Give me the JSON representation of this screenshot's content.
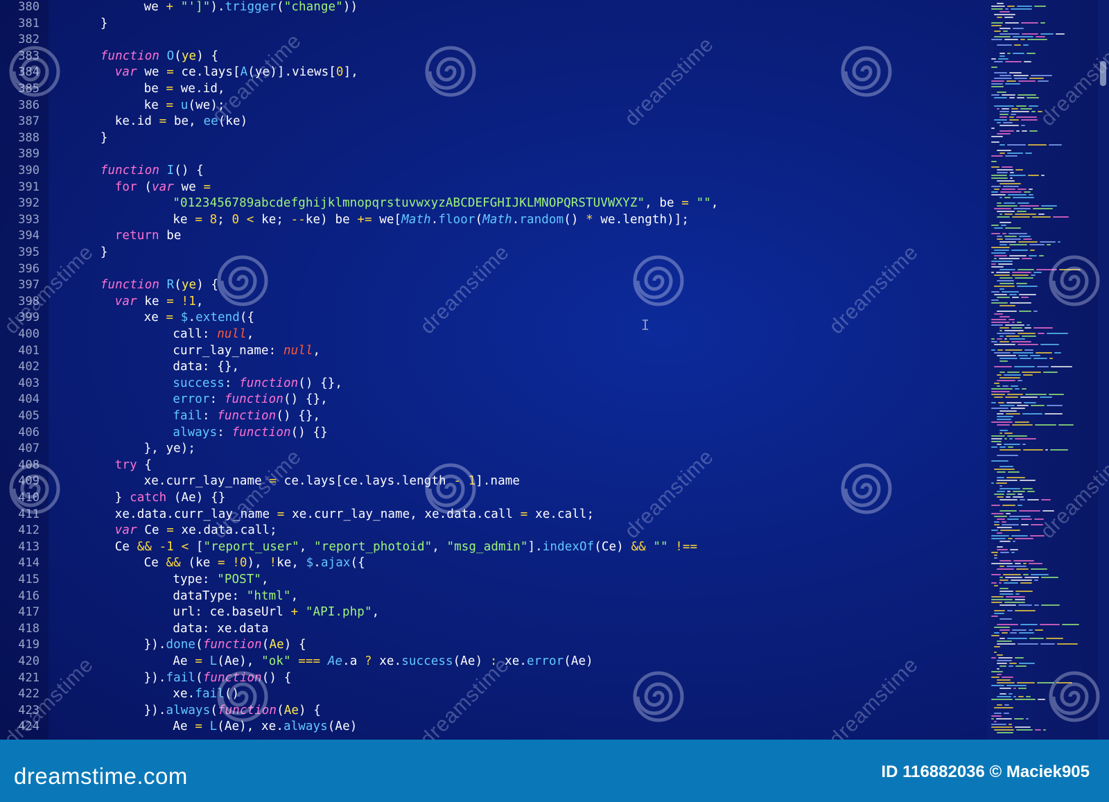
{
  "editor": {
    "lines": [
      {
        "n": "380",
        "indent": 8,
        "tokens": [
          [
            "plain",
            "we "
          ],
          [
            "op",
            "+"
          ],
          [
            "plain",
            " "
          ],
          [
            "str",
            "\"']\""
          ],
          [
            "plain",
            ")."
          ],
          [
            "fn",
            "trigger"
          ],
          [
            "plain",
            "("
          ],
          [
            "str",
            "\"change\""
          ],
          [
            "plain",
            "))"
          ]
        ]
      },
      {
        "n": "381",
        "indent": 2,
        "tokens": [
          [
            "plain",
            "}"
          ]
        ]
      },
      {
        "n": "382",
        "indent": 0,
        "tokens": []
      },
      {
        "n": "383",
        "indent": 2,
        "tokens": [
          [
            "kw",
            "function"
          ],
          [
            "plain",
            " "
          ],
          [
            "fn",
            "O"
          ],
          [
            "plain",
            "("
          ],
          [
            "prm",
            "ye"
          ],
          [
            "plain",
            ") {"
          ]
        ]
      },
      {
        "n": "384",
        "indent": 4,
        "tokens": [
          [
            "kw",
            "var"
          ],
          [
            "plain",
            " we "
          ],
          [
            "op",
            "="
          ],
          [
            "plain",
            " ce.lays["
          ],
          [
            "fn",
            "A"
          ],
          [
            "plain",
            "(ye)].views["
          ],
          [
            "num",
            "0"
          ],
          [
            "plain",
            "],"
          ]
        ]
      },
      {
        "n": "385",
        "indent": 8,
        "tokens": [
          [
            "plain",
            "be "
          ],
          [
            "op",
            "="
          ],
          [
            "plain",
            " we.id,"
          ]
        ]
      },
      {
        "n": "386",
        "indent": 8,
        "tokens": [
          [
            "plain",
            "ke "
          ],
          [
            "op",
            "="
          ],
          [
            "plain",
            " "
          ],
          [
            "fn",
            "u"
          ],
          [
            "plain",
            "(we);"
          ]
        ]
      },
      {
        "n": "387",
        "indent": 4,
        "tokens": [
          [
            "plain",
            "ke.id "
          ],
          [
            "op",
            "="
          ],
          [
            "plain",
            " be, "
          ],
          [
            "fn",
            "ee"
          ],
          [
            "plain",
            "(ke)"
          ]
        ]
      },
      {
        "n": "388",
        "indent": 2,
        "tokens": [
          [
            "plain",
            "}"
          ]
        ]
      },
      {
        "n": "389",
        "indent": 0,
        "tokens": []
      },
      {
        "n": "390",
        "indent": 2,
        "tokens": [
          [
            "kw",
            "function"
          ],
          [
            "plain",
            " "
          ],
          [
            "fn",
            "I"
          ],
          [
            "plain",
            "() {"
          ]
        ]
      },
      {
        "n": "391",
        "indent": 4,
        "tokens": [
          [
            "ctl",
            "for"
          ],
          [
            "plain",
            " ("
          ],
          [
            "kw",
            "var"
          ],
          [
            "plain",
            " we "
          ],
          [
            "op",
            "="
          ]
        ]
      },
      {
        "n": "392",
        "indent": 12,
        "tokens": [
          [
            "str",
            "\"0123456789abcdefghijklmnopqrstuvwxyzABCDEFGHIJKLMNOPQRSTUVWXYZ\""
          ],
          [
            "plain",
            ", be "
          ],
          [
            "op",
            "="
          ],
          [
            "plain",
            " "
          ],
          [
            "str",
            "\"\""
          ],
          [
            "plain",
            ","
          ]
        ]
      },
      {
        "n": "393",
        "indent": 12,
        "tokens": [
          [
            "plain",
            "ke "
          ],
          [
            "op",
            "="
          ],
          [
            "plain",
            " "
          ],
          [
            "num",
            "8"
          ],
          [
            "plain",
            "; "
          ],
          [
            "num",
            "0"
          ],
          [
            "plain",
            " "
          ],
          [
            "op",
            "<"
          ],
          [
            "plain",
            " ke; "
          ],
          [
            "op",
            "--"
          ],
          [
            "plain",
            "ke) be "
          ],
          [
            "op",
            "+="
          ],
          [
            "plain",
            " we["
          ],
          [
            "cls",
            "Math"
          ],
          [
            "plain",
            "."
          ],
          [
            "fn",
            "floor"
          ],
          [
            "plain",
            "("
          ],
          [
            "cls",
            "Math"
          ],
          [
            "plain",
            "."
          ],
          [
            "fn",
            "random"
          ],
          [
            "plain",
            "() "
          ],
          [
            "op",
            "*"
          ],
          [
            "plain",
            " we.length)];"
          ]
        ]
      },
      {
        "n": "394",
        "indent": 4,
        "tokens": [
          [
            "ctl",
            "return"
          ],
          [
            "plain",
            " be"
          ]
        ]
      },
      {
        "n": "395",
        "indent": 2,
        "tokens": [
          [
            "plain",
            "}"
          ]
        ]
      },
      {
        "n": "396",
        "indent": 0,
        "tokens": []
      },
      {
        "n": "397",
        "indent": 2,
        "tokens": [
          [
            "kw",
            "function"
          ],
          [
            "plain",
            " "
          ],
          [
            "fn",
            "R"
          ],
          [
            "plain",
            "("
          ],
          [
            "prm",
            "ye"
          ],
          [
            "plain",
            ") {"
          ]
        ]
      },
      {
        "n": "398",
        "indent": 4,
        "tokens": [
          [
            "kw",
            "var"
          ],
          [
            "plain",
            " ke "
          ],
          [
            "op",
            "="
          ],
          [
            "plain",
            " "
          ],
          [
            "op",
            "!"
          ],
          [
            "num",
            "1"
          ],
          [
            "plain",
            ","
          ]
        ]
      },
      {
        "n": "399",
        "indent": 8,
        "tokens": [
          [
            "plain",
            "xe "
          ],
          [
            "op",
            "="
          ],
          [
            "plain",
            " "
          ],
          [
            "fn",
            "$"
          ],
          [
            "plain",
            "."
          ],
          [
            "fn",
            "extend"
          ],
          [
            "plain",
            "({"
          ]
        ]
      },
      {
        "n": "400",
        "indent": 12,
        "tokens": [
          [
            "plain",
            "call: "
          ],
          [
            "nul",
            "null"
          ],
          [
            "plain",
            ","
          ]
        ]
      },
      {
        "n": "401",
        "indent": 12,
        "tokens": [
          [
            "plain",
            "curr_lay_name: "
          ],
          [
            "nul",
            "null"
          ],
          [
            "plain",
            ","
          ]
        ]
      },
      {
        "n": "402",
        "indent": 12,
        "tokens": [
          [
            "plain",
            "data: {},"
          ]
        ]
      },
      {
        "n": "403",
        "indent": 12,
        "tokens": [
          [
            "key",
            "success"
          ],
          [
            "plain",
            ": "
          ],
          [
            "kw",
            "function"
          ],
          [
            "plain",
            "() {},"
          ]
        ]
      },
      {
        "n": "404",
        "indent": 12,
        "tokens": [
          [
            "key",
            "error"
          ],
          [
            "plain",
            ": "
          ],
          [
            "kw",
            "function"
          ],
          [
            "plain",
            "() {},"
          ]
        ]
      },
      {
        "n": "405",
        "indent": 12,
        "tokens": [
          [
            "key",
            "fail"
          ],
          [
            "plain",
            ": "
          ],
          [
            "kw",
            "function"
          ],
          [
            "plain",
            "() {},"
          ]
        ]
      },
      {
        "n": "406",
        "indent": 12,
        "tokens": [
          [
            "key",
            "always"
          ],
          [
            "plain",
            ": "
          ],
          [
            "kw",
            "function"
          ],
          [
            "plain",
            "() {}"
          ]
        ]
      },
      {
        "n": "407",
        "indent": 8,
        "tokens": [
          [
            "plain",
            "}, ye);"
          ]
        ]
      },
      {
        "n": "408",
        "indent": 4,
        "tokens": [
          [
            "ctl",
            "try"
          ],
          [
            "plain",
            " {"
          ]
        ]
      },
      {
        "n": "409",
        "indent": 8,
        "tokens": [
          [
            "plain",
            "xe.curr_lay_name "
          ],
          [
            "op",
            "="
          ],
          [
            "plain",
            " ce.lays[ce.lays.length "
          ],
          [
            "op",
            "-"
          ],
          [
            "plain",
            " "
          ],
          [
            "num",
            "1"
          ],
          [
            "plain",
            "].name"
          ]
        ]
      },
      {
        "n": "410",
        "indent": 4,
        "tokens": [
          [
            "plain",
            "} "
          ],
          [
            "ctl",
            "catch"
          ],
          [
            "plain",
            " (Ae) {}"
          ]
        ]
      },
      {
        "n": "411",
        "indent": 4,
        "tokens": [
          [
            "plain",
            "xe.data.curr_lay_name "
          ],
          [
            "op",
            "="
          ],
          [
            "plain",
            " xe.curr_lay_name, xe.data.call "
          ],
          [
            "op",
            "="
          ],
          [
            "plain",
            " xe.call;"
          ]
        ]
      },
      {
        "n": "412",
        "indent": 4,
        "tokens": [
          [
            "kw",
            "var"
          ],
          [
            "plain",
            " Ce "
          ],
          [
            "op",
            "="
          ],
          [
            "plain",
            " xe.data.call;"
          ]
        ]
      },
      {
        "n": "413",
        "indent": 4,
        "tokens": [
          [
            "plain",
            "Ce "
          ],
          [
            "op",
            "&&"
          ],
          [
            "plain",
            " "
          ],
          [
            "op",
            "-"
          ],
          [
            "num",
            "1"
          ],
          [
            "plain",
            " "
          ],
          [
            "op",
            "<"
          ],
          [
            "plain",
            " ["
          ],
          [
            "str",
            "\"report_user\""
          ],
          [
            "plain",
            ", "
          ],
          [
            "str",
            "\"report_photoid\""
          ],
          [
            "plain",
            ", "
          ],
          [
            "str",
            "\"msg_admin\""
          ],
          [
            "plain",
            "]."
          ],
          [
            "fn",
            "indexOf"
          ],
          [
            "plain",
            "(Ce) "
          ],
          [
            "op",
            "&&"
          ],
          [
            "plain",
            " "
          ],
          [
            "str",
            "\"\""
          ],
          [
            "plain",
            " "
          ],
          [
            "op",
            "!=="
          ]
        ]
      },
      {
        "n": "414",
        "indent": 8,
        "tokens": [
          [
            "plain",
            "Ce "
          ],
          [
            "op",
            "&&"
          ],
          [
            "plain",
            " (ke "
          ],
          [
            "op",
            "="
          ],
          [
            "plain",
            " "
          ],
          [
            "op",
            "!"
          ],
          [
            "num",
            "0"
          ],
          [
            "plain",
            "), "
          ],
          [
            "op",
            "!"
          ],
          [
            "plain",
            "ke, "
          ],
          [
            "fn",
            "$"
          ],
          [
            "plain",
            "."
          ],
          [
            "fn",
            "ajax"
          ],
          [
            "plain",
            "({"
          ]
        ]
      },
      {
        "n": "415",
        "indent": 12,
        "tokens": [
          [
            "plain",
            "type: "
          ],
          [
            "str",
            "\"POST\""
          ],
          [
            "plain",
            ","
          ]
        ]
      },
      {
        "n": "416",
        "indent": 12,
        "tokens": [
          [
            "plain",
            "dataType: "
          ],
          [
            "str",
            "\"html\""
          ],
          [
            "plain",
            ","
          ]
        ]
      },
      {
        "n": "417",
        "indent": 12,
        "tokens": [
          [
            "plain",
            "url: ce.baseUrl "
          ],
          [
            "op",
            "+"
          ],
          [
            "plain",
            " "
          ],
          [
            "str",
            "\"API.php\""
          ],
          [
            "plain",
            ","
          ]
        ]
      },
      {
        "n": "418",
        "indent": 12,
        "tokens": [
          [
            "plain",
            "data: xe.data"
          ]
        ]
      },
      {
        "n": "419",
        "indent": 8,
        "tokens": [
          [
            "plain",
            "})."
          ],
          [
            "fn",
            "done"
          ],
          [
            "plain",
            "("
          ],
          [
            "kw",
            "function"
          ],
          [
            "plain",
            "("
          ],
          [
            "prm",
            "Ae"
          ],
          [
            "plain",
            ") {"
          ]
        ]
      },
      {
        "n": "420",
        "indent": 12,
        "tokens": [
          [
            "plain",
            "Ae "
          ],
          [
            "op",
            "="
          ],
          [
            "plain",
            " "
          ],
          [
            "fn",
            "L"
          ],
          [
            "plain",
            "(Ae), "
          ],
          [
            "str",
            "\"ok\""
          ],
          [
            "plain",
            " "
          ],
          [
            "op",
            "==="
          ],
          [
            "plain",
            " "
          ],
          [
            "cls",
            "Ae"
          ],
          [
            "plain",
            ".a "
          ],
          [
            "op",
            "?"
          ],
          [
            "plain",
            " xe."
          ],
          [
            "fn",
            "success"
          ],
          [
            "plain",
            "(Ae) "
          ],
          [
            "op",
            ":"
          ],
          [
            "plain",
            " xe."
          ],
          [
            "fn",
            "error"
          ],
          [
            "plain",
            "(Ae)"
          ]
        ]
      },
      {
        "n": "421",
        "indent": 8,
        "tokens": [
          [
            "plain",
            "})."
          ],
          [
            "fn",
            "fail"
          ],
          [
            "plain",
            "("
          ],
          [
            "kw",
            "function"
          ],
          [
            "plain",
            "() {"
          ]
        ]
      },
      {
        "n": "422",
        "indent": 12,
        "tokens": [
          [
            "plain",
            "xe."
          ],
          [
            "fn",
            "fail"
          ],
          [
            "plain",
            "()"
          ]
        ]
      },
      {
        "n": "423",
        "indent": 8,
        "tokens": [
          [
            "plain",
            "})."
          ],
          [
            "fn",
            "always"
          ],
          [
            "plain",
            "("
          ],
          [
            "kw",
            "function"
          ],
          [
            "plain",
            "("
          ],
          [
            "prm",
            "Ae"
          ],
          [
            "plain",
            ") {"
          ]
        ]
      },
      {
        "n": "424",
        "indent": 12,
        "tokens": [
          [
            "plain",
            "Ae "
          ],
          [
            "op",
            "="
          ],
          [
            "plain",
            " "
          ],
          [
            "fn",
            "L"
          ],
          [
            "plain",
            "(Ae), xe."
          ],
          [
            "fn",
            "always"
          ],
          [
            "plain",
            "(Ae)"
          ]
        ]
      }
    ]
  },
  "watermark": {
    "text": "dreamstime",
    "icon": "dreamstime-spiral-icon"
  },
  "footer": {
    "logo": "dreamstime.com",
    "id_text": "ID 116882036 © Maciek905"
  },
  "colors": {
    "background": "#0a1f7e",
    "keyword": "#ff72d2",
    "function": "#62c8ff",
    "string": "#9ff57a",
    "number": "#ffd83a",
    "null": "#ff5a3c",
    "footer": "#0a78b8"
  }
}
